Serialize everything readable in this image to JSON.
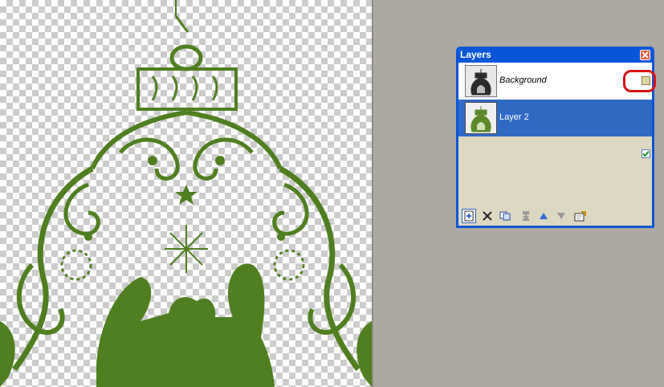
{
  "canvas": {
    "image": "christmas-ornament-nativity-green"
  },
  "layers_panel": {
    "title": "Layers",
    "layers": [
      {
        "name": "Background",
        "visible": false,
        "selected": false,
        "thumbnail": "ornament-dark-thumbnail"
      },
      {
        "name": "Layer 2",
        "visible": true,
        "selected": true,
        "thumbnail": "ornament-green-thumbnail"
      }
    ],
    "toolbar_icons": [
      "add-layer-icon",
      "delete-layer-icon",
      "duplicate-layer-icon",
      "merge-layer-icon",
      "move-up-icon",
      "move-down-icon",
      "layer-properties-icon"
    ]
  },
  "colors": {
    "accent": "#0a56d8",
    "selection": "#316ac5",
    "ornament_green": "#4f7f20",
    "annotation": "#d91414"
  }
}
